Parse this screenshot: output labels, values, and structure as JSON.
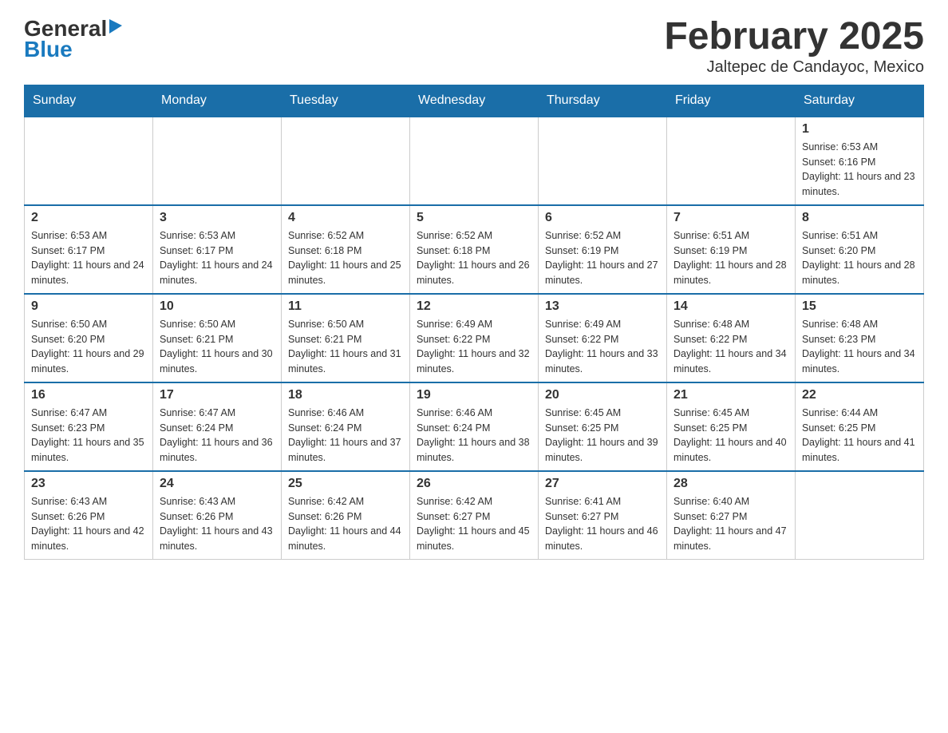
{
  "header": {
    "logo": {
      "general": "General",
      "triangle": "▶",
      "blue": "Blue"
    },
    "title": "February 2025",
    "subtitle": "Jaltepec de Candayoc, Mexico"
  },
  "days_of_week": [
    "Sunday",
    "Monday",
    "Tuesday",
    "Wednesday",
    "Thursday",
    "Friday",
    "Saturday"
  ],
  "weeks": [
    [
      {
        "day": "",
        "sunrise": "",
        "sunset": "",
        "daylight": ""
      },
      {
        "day": "",
        "sunrise": "",
        "sunset": "",
        "daylight": ""
      },
      {
        "day": "",
        "sunrise": "",
        "sunset": "",
        "daylight": ""
      },
      {
        "day": "",
        "sunrise": "",
        "sunset": "",
        "daylight": ""
      },
      {
        "day": "",
        "sunrise": "",
        "sunset": "",
        "daylight": ""
      },
      {
        "day": "",
        "sunrise": "",
        "sunset": "",
        "daylight": ""
      },
      {
        "day": "1",
        "sunrise": "Sunrise: 6:53 AM",
        "sunset": "Sunset: 6:16 PM",
        "daylight": "Daylight: 11 hours and 23 minutes."
      }
    ],
    [
      {
        "day": "2",
        "sunrise": "Sunrise: 6:53 AM",
        "sunset": "Sunset: 6:17 PM",
        "daylight": "Daylight: 11 hours and 24 minutes."
      },
      {
        "day": "3",
        "sunrise": "Sunrise: 6:53 AM",
        "sunset": "Sunset: 6:17 PM",
        "daylight": "Daylight: 11 hours and 24 minutes."
      },
      {
        "day": "4",
        "sunrise": "Sunrise: 6:52 AM",
        "sunset": "Sunset: 6:18 PM",
        "daylight": "Daylight: 11 hours and 25 minutes."
      },
      {
        "day": "5",
        "sunrise": "Sunrise: 6:52 AM",
        "sunset": "Sunset: 6:18 PM",
        "daylight": "Daylight: 11 hours and 26 minutes."
      },
      {
        "day": "6",
        "sunrise": "Sunrise: 6:52 AM",
        "sunset": "Sunset: 6:19 PM",
        "daylight": "Daylight: 11 hours and 27 minutes."
      },
      {
        "day": "7",
        "sunrise": "Sunrise: 6:51 AM",
        "sunset": "Sunset: 6:19 PM",
        "daylight": "Daylight: 11 hours and 28 minutes."
      },
      {
        "day": "8",
        "sunrise": "Sunrise: 6:51 AM",
        "sunset": "Sunset: 6:20 PM",
        "daylight": "Daylight: 11 hours and 28 minutes."
      }
    ],
    [
      {
        "day": "9",
        "sunrise": "Sunrise: 6:50 AM",
        "sunset": "Sunset: 6:20 PM",
        "daylight": "Daylight: 11 hours and 29 minutes."
      },
      {
        "day": "10",
        "sunrise": "Sunrise: 6:50 AM",
        "sunset": "Sunset: 6:21 PM",
        "daylight": "Daylight: 11 hours and 30 minutes."
      },
      {
        "day": "11",
        "sunrise": "Sunrise: 6:50 AM",
        "sunset": "Sunset: 6:21 PM",
        "daylight": "Daylight: 11 hours and 31 minutes."
      },
      {
        "day": "12",
        "sunrise": "Sunrise: 6:49 AM",
        "sunset": "Sunset: 6:22 PM",
        "daylight": "Daylight: 11 hours and 32 minutes."
      },
      {
        "day": "13",
        "sunrise": "Sunrise: 6:49 AM",
        "sunset": "Sunset: 6:22 PM",
        "daylight": "Daylight: 11 hours and 33 minutes."
      },
      {
        "day": "14",
        "sunrise": "Sunrise: 6:48 AM",
        "sunset": "Sunset: 6:22 PM",
        "daylight": "Daylight: 11 hours and 34 minutes."
      },
      {
        "day": "15",
        "sunrise": "Sunrise: 6:48 AM",
        "sunset": "Sunset: 6:23 PM",
        "daylight": "Daylight: 11 hours and 34 minutes."
      }
    ],
    [
      {
        "day": "16",
        "sunrise": "Sunrise: 6:47 AM",
        "sunset": "Sunset: 6:23 PM",
        "daylight": "Daylight: 11 hours and 35 minutes."
      },
      {
        "day": "17",
        "sunrise": "Sunrise: 6:47 AM",
        "sunset": "Sunset: 6:24 PM",
        "daylight": "Daylight: 11 hours and 36 minutes."
      },
      {
        "day": "18",
        "sunrise": "Sunrise: 6:46 AM",
        "sunset": "Sunset: 6:24 PM",
        "daylight": "Daylight: 11 hours and 37 minutes."
      },
      {
        "day": "19",
        "sunrise": "Sunrise: 6:46 AM",
        "sunset": "Sunset: 6:24 PM",
        "daylight": "Daylight: 11 hours and 38 minutes."
      },
      {
        "day": "20",
        "sunrise": "Sunrise: 6:45 AM",
        "sunset": "Sunset: 6:25 PM",
        "daylight": "Daylight: 11 hours and 39 minutes."
      },
      {
        "day": "21",
        "sunrise": "Sunrise: 6:45 AM",
        "sunset": "Sunset: 6:25 PM",
        "daylight": "Daylight: 11 hours and 40 minutes."
      },
      {
        "day": "22",
        "sunrise": "Sunrise: 6:44 AM",
        "sunset": "Sunset: 6:25 PM",
        "daylight": "Daylight: 11 hours and 41 minutes."
      }
    ],
    [
      {
        "day": "23",
        "sunrise": "Sunrise: 6:43 AM",
        "sunset": "Sunset: 6:26 PM",
        "daylight": "Daylight: 11 hours and 42 minutes."
      },
      {
        "day": "24",
        "sunrise": "Sunrise: 6:43 AM",
        "sunset": "Sunset: 6:26 PM",
        "daylight": "Daylight: 11 hours and 43 minutes."
      },
      {
        "day": "25",
        "sunrise": "Sunrise: 6:42 AM",
        "sunset": "Sunset: 6:26 PM",
        "daylight": "Daylight: 11 hours and 44 minutes."
      },
      {
        "day": "26",
        "sunrise": "Sunrise: 6:42 AM",
        "sunset": "Sunset: 6:27 PM",
        "daylight": "Daylight: 11 hours and 45 minutes."
      },
      {
        "day": "27",
        "sunrise": "Sunrise: 6:41 AM",
        "sunset": "Sunset: 6:27 PM",
        "daylight": "Daylight: 11 hours and 46 minutes."
      },
      {
        "day": "28",
        "sunrise": "Sunrise: 6:40 AM",
        "sunset": "Sunset: 6:27 PM",
        "daylight": "Daylight: 11 hours and 47 minutes."
      },
      {
        "day": "",
        "sunrise": "",
        "sunset": "",
        "daylight": ""
      }
    ]
  ]
}
